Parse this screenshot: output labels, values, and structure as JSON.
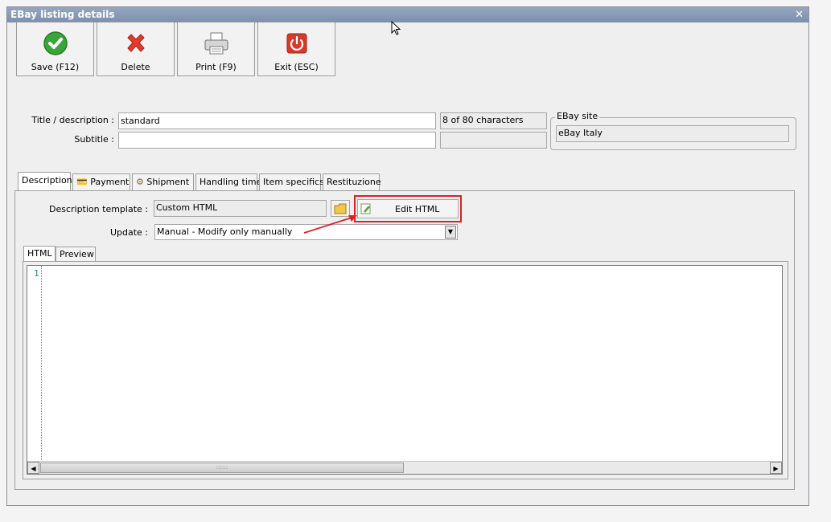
{
  "window": {
    "title": "EBay listing details"
  },
  "toolbar": {
    "save_label": "Save (F12)",
    "delete_label": "Delete",
    "print_label": "Print (F9)",
    "exit_label": "Exit (ESC)"
  },
  "form": {
    "title_label": "Title / description :",
    "title_value": "standard",
    "char_count": "8 of 80 characters",
    "subtitle_label": "Subtitle :",
    "subtitle_value": "",
    "ebay_site_group": "EBay site",
    "ebay_site_value": "eBay Italy"
  },
  "tabs": [
    {
      "label": "Description"
    },
    {
      "label": "Payment"
    },
    {
      "label": "Shipment"
    },
    {
      "label": "Handling time"
    },
    {
      "label": "Item specifics"
    },
    {
      "label": "Restituzione"
    }
  ],
  "description": {
    "template_label": "Description template :",
    "template_value": "Custom HTML",
    "edit_html_label": "Edit HTML",
    "update_label": "Update :",
    "update_value": "Manual - Modify only manually"
  },
  "editor_tabs": [
    {
      "label": "HTML"
    },
    {
      "label": "Preview"
    }
  ],
  "editor": {
    "line_number": "1"
  },
  "colors": {
    "titlebar": "#8596b4",
    "highlight": "#e02020",
    "accent_green": "#3aa63a",
    "exit_red": "#d83a2a"
  }
}
